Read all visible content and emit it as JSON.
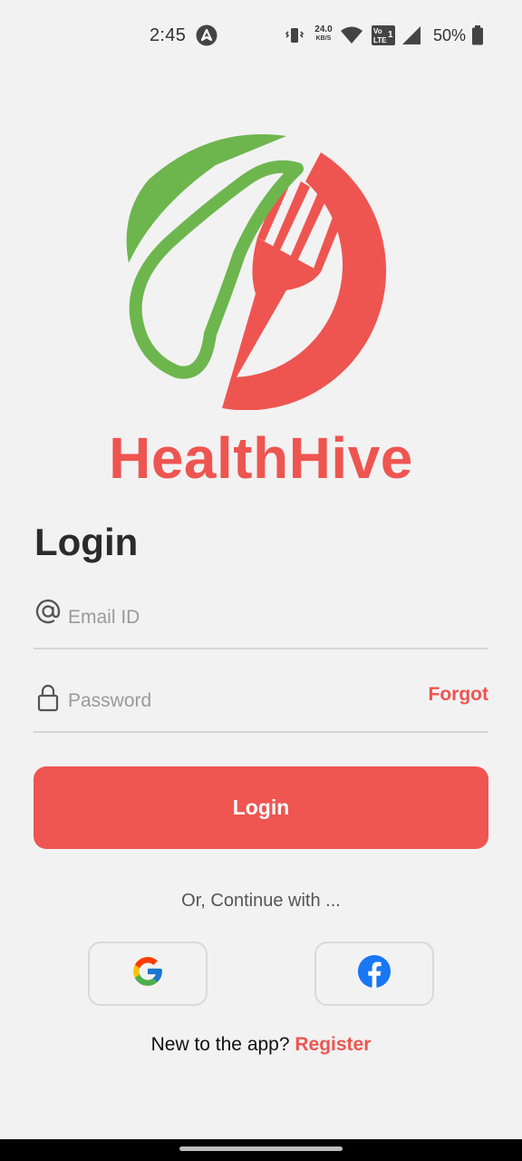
{
  "status_bar": {
    "time": "2:45",
    "app_icon": "navigation-arrow-icon",
    "vibrate_icon": "vibrate-icon",
    "net_speed_value": "24.0",
    "net_speed_unit": "KB/S",
    "wifi_icon": "wifi-icon",
    "volte_icon": "volte-lte-icon",
    "signal_icon": "cell-signal-icon",
    "battery_percent": "50%",
    "battery_icon": "battery-icon"
  },
  "brand": {
    "name": "HealthHive",
    "logo_icon": "leaf-spoon-fork-logo",
    "colors": {
      "primary": "#ee5550",
      "green": "#6db64e"
    }
  },
  "login": {
    "title": "Login",
    "email_placeholder": "Email ID",
    "email_value": "",
    "email_icon": "at-sign-icon",
    "password_placeholder": "Password",
    "password_value": "",
    "password_icon": "lock-icon",
    "forgot_label": "Forgot",
    "submit_label": "Login"
  },
  "social": {
    "divider_text": "Or, Continue with ...",
    "google_icon": "google-icon",
    "facebook_icon": "facebook-icon"
  },
  "register": {
    "prompt": "New to the app? ",
    "link_label": "Register"
  }
}
